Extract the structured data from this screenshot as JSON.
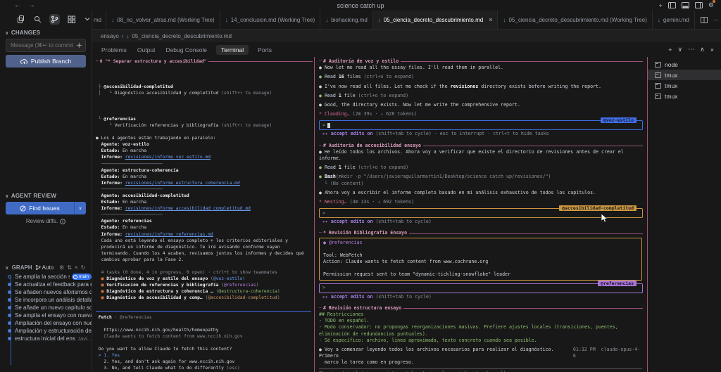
{
  "titlebar": {
    "title": "science catch up",
    "back": "←",
    "forward": "→",
    "plus": "+"
  },
  "sidebar": {
    "changes": {
      "label": "CHANGES",
      "message_placeholder": "Message (⌘↵ to commit ...",
      "publish_label": "Publish Branch"
    },
    "agent_review": {
      "label": "AGENT REVIEW",
      "find_issues_label": "Find Issues",
      "review_diffs_label": "Review diffs."
    },
    "graph": {
      "label": "GRAPH",
      "auto_label": "Auto",
      "toolbar_icons": [
        "gear",
        "fetch",
        "swap",
        "refresh"
      ],
      "commits": [
        {
          "label": "Se amplía la sección so...",
          "badge": "main",
          "head": true
        },
        {
          "label": "Se actualiza el feedback para en..."
        },
        {
          "label": "Se añaden nuevos aforismos qu..."
        },
        {
          "label": "Se incorpora un análisis detallad..."
        },
        {
          "label": "Se añade un nuevo capítulo sob..."
        },
        {
          "label": "Se amplía el ensayo con nuevas ..."
        },
        {
          "label": "Ampliación del ensayo con nuev..."
        },
        {
          "label": "Ampliación y estructuración del ..."
        },
        {
          "label": "estructura inicial del ensayo",
          "meta": "Javi..."
        }
      ]
    }
  },
  "editor": {
    "leading_tab_fragment": "md",
    "tabs": [
      {
        "label": "08_no_volver_atras.md (Working Tree)"
      },
      {
        "label": "14_conclusion.md (Working Tree)"
      },
      {
        "label": "biohacking.md"
      },
      {
        "label": "05_ciencia_decreto_descubrimiento.md",
        "active": true,
        "close": "×"
      },
      {
        "label": "05_ciencia_decreto_descubrimiento.md (Working Tree)"
      },
      {
        "label": "gemini.md"
      }
    ],
    "breadcrumb": {
      "folder": "ensayo",
      "separator": "›",
      "file": "05_ciencia_decreto_descubrimiento.md"
    }
  },
  "panel": {
    "tabs": [
      "Problems",
      "Output",
      "Debug Console",
      "Terminal",
      "Ports"
    ],
    "active_tab": "Terminal",
    "actions": [
      "+",
      "∨",
      "⋯",
      "∧",
      "×"
    ]
  },
  "terminal_sidebar": {
    "items": [
      {
        "label": "node"
      },
      {
        "label": "tmux",
        "active": true
      },
      {
        "label": "tmux"
      },
      {
        "label": "tmux"
      }
    ]
  },
  "colors": {
    "rose_border": "#9e5178",
    "blue_accent": "#3f6ee8",
    "orange_accent": "#c9963f",
    "purple_accent": "#a873d9",
    "green": "#8fbf6f",
    "link": "#6c9ff8",
    "task_square": "#cf6a3c",
    "main_badge": "#3574f0"
  },
  "terminal": {
    "left_pane_title": "0 \"* Separar estructura y accesibilidad\"",
    "left": [
      {
        "t": "title"
      },
      {},
      {},
      {},
      {
        "s": [
          [
            "dim",
            " ├ "
          ],
          [
            "b",
            "@accesibilidad-completitud"
          ]
        ]
      },
      {
        "s": [
          [
            "dim",
            " │   └ "
          ],
          [
            "w",
            "Diagnóstico accesibilidad y completitud "
          ],
          [
            "dim",
            "(shift+↑ to manage)"
          ]
        ]
      },
      {},
      {},
      {},
      {
        "s": [
          [
            "dim",
            " └ "
          ],
          [
            "b",
            "@referencias"
          ]
        ]
      },
      {
        "s": [
          [
            "dim",
            "     └ "
          ],
          [
            "w",
            "Verificación referencias y bibliografía "
          ],
          [
            "dim",
            "(shift+↑ to manage)"
          ]
        ]
      },
      {},
      {
        "s": [
          [
            "w",
            "● Los 4 agentes están trabajando en paralelo:"
          ]
        ]
      },
      {
        "s": [
          [
            "b",
            "  Agente: voz-estilo"
          ]
        ]
      },
      {
        "s": [
          [
            "b",
            "  Estado: "
          ],
          [
            "w",
            "En marcha"
          ]
        ]
      },
      {
        "s": [
          [
            "b",
            "  Informe: "
          ],
          [
            "lnk",
            "revisiones/informe_voz_estilo.md"
          ]
        ]
      },
      {
        "s": [
          [
            "dim",
            "  ───────────────────────"
          ]
        ]
      },
      {
        "s": [
          [
            "b",
            "  Agente: estructura-coherencia"
          ]
        ]
      },
      {
        "s": [
          [
            "b",
            "  Estado: "
          ],
          [
            "w",
            "En marcha"
          ]
        ]
      },
      {
        "s": [
          [
            "b",
            "  Informe: "
          ],
          [
            "lnk",
            "revisiones/informe_estructura_coherencia.md"
          ]
        ]
      },
      {
        "s": [
          [
            "dim",
            "  ───────────────────────"
          ]
        ]
      },
      {
        "s": [
          [
            "b",
            "  Agente: accesibilidad-completitud"
          ]
        ]
      },
      {
        "s": [
          [
            "b",
            "  Estado: "
          ],
          [
            "w",
            "En marcha"
          ]
        ]
      },
      {
        "s": [
          [
            "b",
            "  Informe: "
          ],
          [
            "lnk",
            "revisiones/informe_accesibilidad_completitud.md"
          ]
        ]
      },
      {
        "s": [
          [
            "dim",
            "  ───────────────────────"
          ]
        ]
      },
      {
        "s": [
          [
            "b",
            "  Agente: referencias"
          ]
        ]
      },
      {
        "s": [
          [
            "b",
            "  Estado: "
          ],
          [
            "w",
            "En marcha"
          ]
        ]
      },
      {
        "s": [
          [
            "b",
            "  Informe: "
          ],
          [
            "lnk",
            "revisiones/informe_referencias.md"
          ]
        ]
      },
      {
        "s": [
          [
            "w",
            "  Cada uno está leyendo el ensayo completo + los criterios editoriales y"
          ]
        ]
      },
      {
        "s": [
          [
            "w",
            "  producirá un informe de diagnóstico. Te iré avisando conforme vayan"
          ]
        ]
      },
      {
        "s": [
          [
            "w",
            "  terminando. Cuando los 4 acaben, revisamos juntos los informes y decides qué"
          ]
        ]
      },
      {
        "s": [
          [
            "w",
            "  cambios aprobar para la Fase 2."
          ]
        ]
      },
      {},
      {
        "s": [
          [
            "dim",
            "  4 tasks (0 done, 4 in progress, 0 open) · ctrl+t to show teammates"
          ]
        ]
      },
      {
        "s": [
          [
            "sq",
            "  ■ "
          ],
          [
            "b",
            "Diagnóstico de voz y estilo del ensayo "
          ],
          [
            "dim",
            "("
          ],
          [
            "blu",
            "@voz-estilo"
          ],
          [
            "dim",
            ")"
          ]
        ]
      },
      {
        "s": [
          [
            "sq",
            "  ■ "
          ],
          [
            "b",
            "Verificación de referencias y bibliografía "
          ],
          [
            "dim",
            "("
          ],
          [
            "pur",
            "@referencias"
          ],
          [
            "dim",
            ")"
          ]
        ]
      },
      {
        "s": [
          [
            "sq",
            "  ■ "
          ],
          [
            "b",
            "Diagnóstico de estructura y coherencia … "
          ],
          [
            "dim",
            "("
          ],
          [
            "grn",
            "@estructura-coherencia"
          ],
          [
            "dim",
            ")"
          ]
        ]
      },
      {
        "s": [
          [
            "sq",
            "  ■ "
          ],
          [
            "b",
            "Diagnóstico de accesibilidad y comp… "
          ],
          [
            "dim",
            "("
          ],
          [
            "yel",
            "@accesibilidad-completitud"
          ],
          [
            "dim",
            ")"
          ]
        ]
      },
      {},
      {
        "t": "rule",
        "c": "#3f6ee8"
      },
      {
        "s": [
          [
            "b",
            " Fetch"
          ],
          [
            "dim",
            " · @referencias"
          ]
        ]
      },
      {},
      {
        "s": [
          [
            "w",
            "   https://www.nccih.nih.gov/health/homeopathy"
          ]
        ]
      },
      {
        "s": [
          [
            "dim",
            "   Claude wants to fetch content from www.nccih.nih.gov"
          ]
        ]
      },
      {},
      {
        "s": [
          [
            "w",
            " Do you want to allow Claude to fetch this content?"
          ]
        ]
      },
      {
        "s": [
          [
            "blu",
            " > 1. Yes"
          ]
        ]
      },
      {
        "s": [
          [
            "w",
            "   2. Yes, and don't ask again for www.nccih.nih.gov"
          ]
        ]
      },
      {
        "s": [
          [
            "w",
            "   3. No, and tell Claude what to do differently "
          ],
          [
            "dim",
            "(esc)"
          ]
        ]
      }
    ],
    "panes": [
      {
        "title": "# Auditoría de voz y estilo",
        "accent": "#3f6ee8",
        "badge": "@voz-estilo",
        "prompt": ">",
        "cursor": true,
        "hint": [
          [
            "purb",
            "▸▸ accept edits on"
          ],
          [
            "dim",
            " (shift+tab to cycle) · esc to interrupt · ctrl+t to hide tasks"
          ]
        ],
        "lines": [
          {
            "s": [
              [
                "w",
                "● Now let me read all the essay files. I'll read them in parallel."
              ]
            ],
            "g": 1
          },
          {
            "s": [
              [
                "grn",
                "● "
              ],
              [
                "w",
                "Read "
              ],
              [
                "b",
                "16"
              ],
              [
                "w",
                " files "
              ],
              [
                "dim",
                "(ctrl+o to expand)"
              ]
            ],
            "g": 1
          },
          {
            "s": [
              [
                "w",
                "● I've now read all files. Let me check if the "
              ],
              [
                "b",
                "revisiones"
              ],
              [
                "w",
                " directory exists before writing the report."
              ]
            ],
            "g": 1
          },
          {
            "s": [
              [
                "grn",
                "● "
              ],
              [
                "w",
                "Read "
              ],
              [
                "b",
                "1"
              ],
              [
                "w",
                " file "
              ],
              [
                "dim",
                "(ctrl+o to expand)"
              ]
            ],
            "g": 1
          },
          {
            "s": [
              [
                "w",
                "● Good, the directory exists. Now let me write the comprehensive report."
              ]
            ],
            "g": 1
          },
          {
            "s": [
              [
                "pnk",
                "* Clauding… "
              ],
              [
                "dim",
                "(2m 39s · ↓ 628 tokens)"
              ]
            ],
            "g": 1
          }
        ]
      },
      {
        "title": "# Auditoría de accesibilidad ensayo",
        "accent": "#c9963f",
        "badge": "@accesibilidad-completitud",
        "prompt": ">",
        "hint": [
          [
            "purb",
            "▸▸ accept edits on"
          ],
          [
            "dim",
            " (shift+tab to cycle)"
          ]
        ],
        "lines": [
          {
            "s": [
              [
                "w",
                "● He leído todos los archivos. Ahora voy a verificar que existe el directorio de revisiones antes de crear el informe."
              ]
            ],
            "g": 1
          },
          {
            "s": [
              [
                "grn",
                "● "
              ],
              [
                "w",
                "Read "
              ],
              [
                "b",
                "1"
              ],
              [
                "w",
                " file "
              ],
              [
                "dim",
                "(ctrl+o to expand)"
              ]
            ],
            "g": 1
          },
          {
            "s": [
              [
                "grn",
                "● "
              ],
              [
                "b",
                "Bash"
              ],
              [
                "dim",
                "(mkdir -p \"/Users/javieraguilarmartin1/Desktop/science catch up/revisiones/\")"
              ]
            ]
          },
          {
            "s": [
              [
                "dim",
                "  └ (No content)"
              ]
            ],
            "g": 1
          },
          {
            "s": [
              [
                "w",
                "● Ahora voy a escribir el informe completo basado en mi análisis exhaustivo de todos los capítulos."
              ]
            ],
            "g": 1
          },
          {
            "s": [
              [
                "pnk",
                "* Nesting… "
              ],
              [
                "dim",
                "(4m 13s · ↓ 692 tokens)"
              ]
            ],
            "g": 1
          }
        ]
      },
      {
        "title": "* Revisión Bibliografía Ensayo",
        "accent": "#a873d9",
        "badge": "@referencias",
        "prompt": ">",
        "hint": [
          [
            "purb",
            "▸▸ accept edits on"
          ],
          [
            "dim",
            " (shift+tab to cycle)"
          ]
        ],
        "box": {
          "border": "#c9963f",
          "lines": [
            {
              "s": [
                [
                  "pur",
                  "● @referencias"
                ]
              ]
            },
            {},
            {
              "s": [
                [
                  "w",
                  "Tool: WebFetch"
                ]
              ]
            },
            {
              "s": [
                [
                  "w",
                  "Action: Claude wants to fetch content from www.cochrane.org"
                ]
              ]
            },
            {},
            {
              "s": [
                [
                  "w",
                  "Permission request sent to team \"dynamic-tickling-snowflake\" leader"
                ]
              ]
            }
          ]
        },
        "lines": []
      },
      {
        "title": "# Revisión estructura ensayo",
        "accent": null,
        "lines": [
          {
            "s": [
              [
                "grn",
                "## Restricciones"
              ]
            ]
          },
          {
            "s": [
              [
                "grn",
                "- TODO en español."
              ]
            ]
          },
          {
            "s": [
              [
                "grn",
                "- Modo conservador: no propongas reorganizaciones masivas. Prefiere ajustes locales (transiciones, puentes, eliminación de redundancias puntuales)."
              ]
            ]
          },
          {
            "s": [
              [
                "grn",
                "- Sé específico: archivo, línea aproximada, texto concreto cuando sea posible."
              ]
            ],
            "g": 1
          },
          {
            "s": [
              [
                "w",
                "● Voy a comenzar leyendo todos los archivos necesarios para realizar el diagnóstico. Primero"
              ]
            ],
            "right": [
              [
                "dim",
                "01:32 PM  claude-opus-4-6"
              ]
            ]
          },
          {
            "s": [
              [
                "w",
                "  marco la tarea como en progreso."
              ]
            ]
          }
        ],
        "footer_rule": true,
        "footer": [
          [
            "dim",
            "Showing detailed transcript · ctrl+o to toggle · ctrl+e to show all"
          ]
        ]
      }
    ]
  }
}
